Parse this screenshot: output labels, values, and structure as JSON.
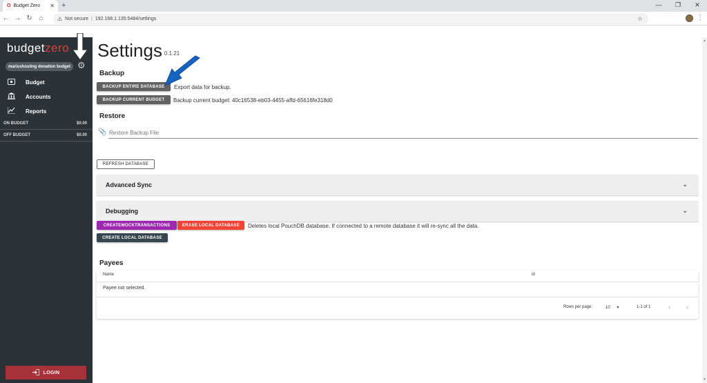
{
  "browser": {
    "tab_title": "Budget Zero",
    "tab_favicon": "O",
    "new_tab": "+",
    "security_label": "Not secure",
    "url": "192.168.1.135:5484/settings"
  },
  "sidebar": {
    "logo_first": "budget",
    "logo_second": "zero",
    "budget_name": "mariushosting donation budget",
    "nav": [
      {
        "label": "Budget",
        "icon": "wallet-icon"
      },
      {
        "label": "Accounts",
        "icon": "bank-icon"
      },
      {
        "label": "Reports",
        "icon": "chart-icon"
      }
    ],
    "on_budget_label": "ON BUDGET",
    "on_budget_value": "$0.00",
    "off_budget_label": "OFF BUDGET",
    "off_budget_value": "$0.00",
    "login_label": "LOGIN"
  },
  "settings": {
    "title": "Settings",
    "version": "0.1.21",
    "backup_heading": "Backup",
    "backup_entire_label": "BACKUP ENTIRE DATABASE",
    "backup_entire_desc": "Export data for backup.",
    "backup_current_label": "BACKUP CURRENT BUDGET",
    "backup_current_desc": "Backup current budget: 40c16538-eb03-4455-affd-65616fe318d0",
    "restore_heading": "Restore",
    "restore_placeholder": "Restore Backup File",
    "refresh_label": "REFRESH DATABASE",
    "advanced_sync_label": "Advanced Sync",
    "debugging_label": "Debugging",
    "create_mock_label": "CREATEMOCKTRANSACTIONS",
    "erase_local_label": "ERASE LOCAL DATABASE",
    "erase_desc": "Deletes local PouchDB database. If connected to a remote database it will re-sync all the data.",
    "create_local_label": "CREATE LOCAL DATABASE"
  },
  "payees": {
    "heading": "Payees",
    "columns": [
      "Name",
      "id"
    ],
    "empty_text": "Payee not selected.",
    "rows_per_page_label": "Rows per page:",
    "rows_per_page_value": "10",
    "range_text": "1-1 of 1"
  },
  "colors": {
    "sidebar_bg": "#2c3338",
    "brand_red": "#e53935",
    "login_bg": "#a8323a",
    "annotation_arrow": "#1565c0"
  }
}
